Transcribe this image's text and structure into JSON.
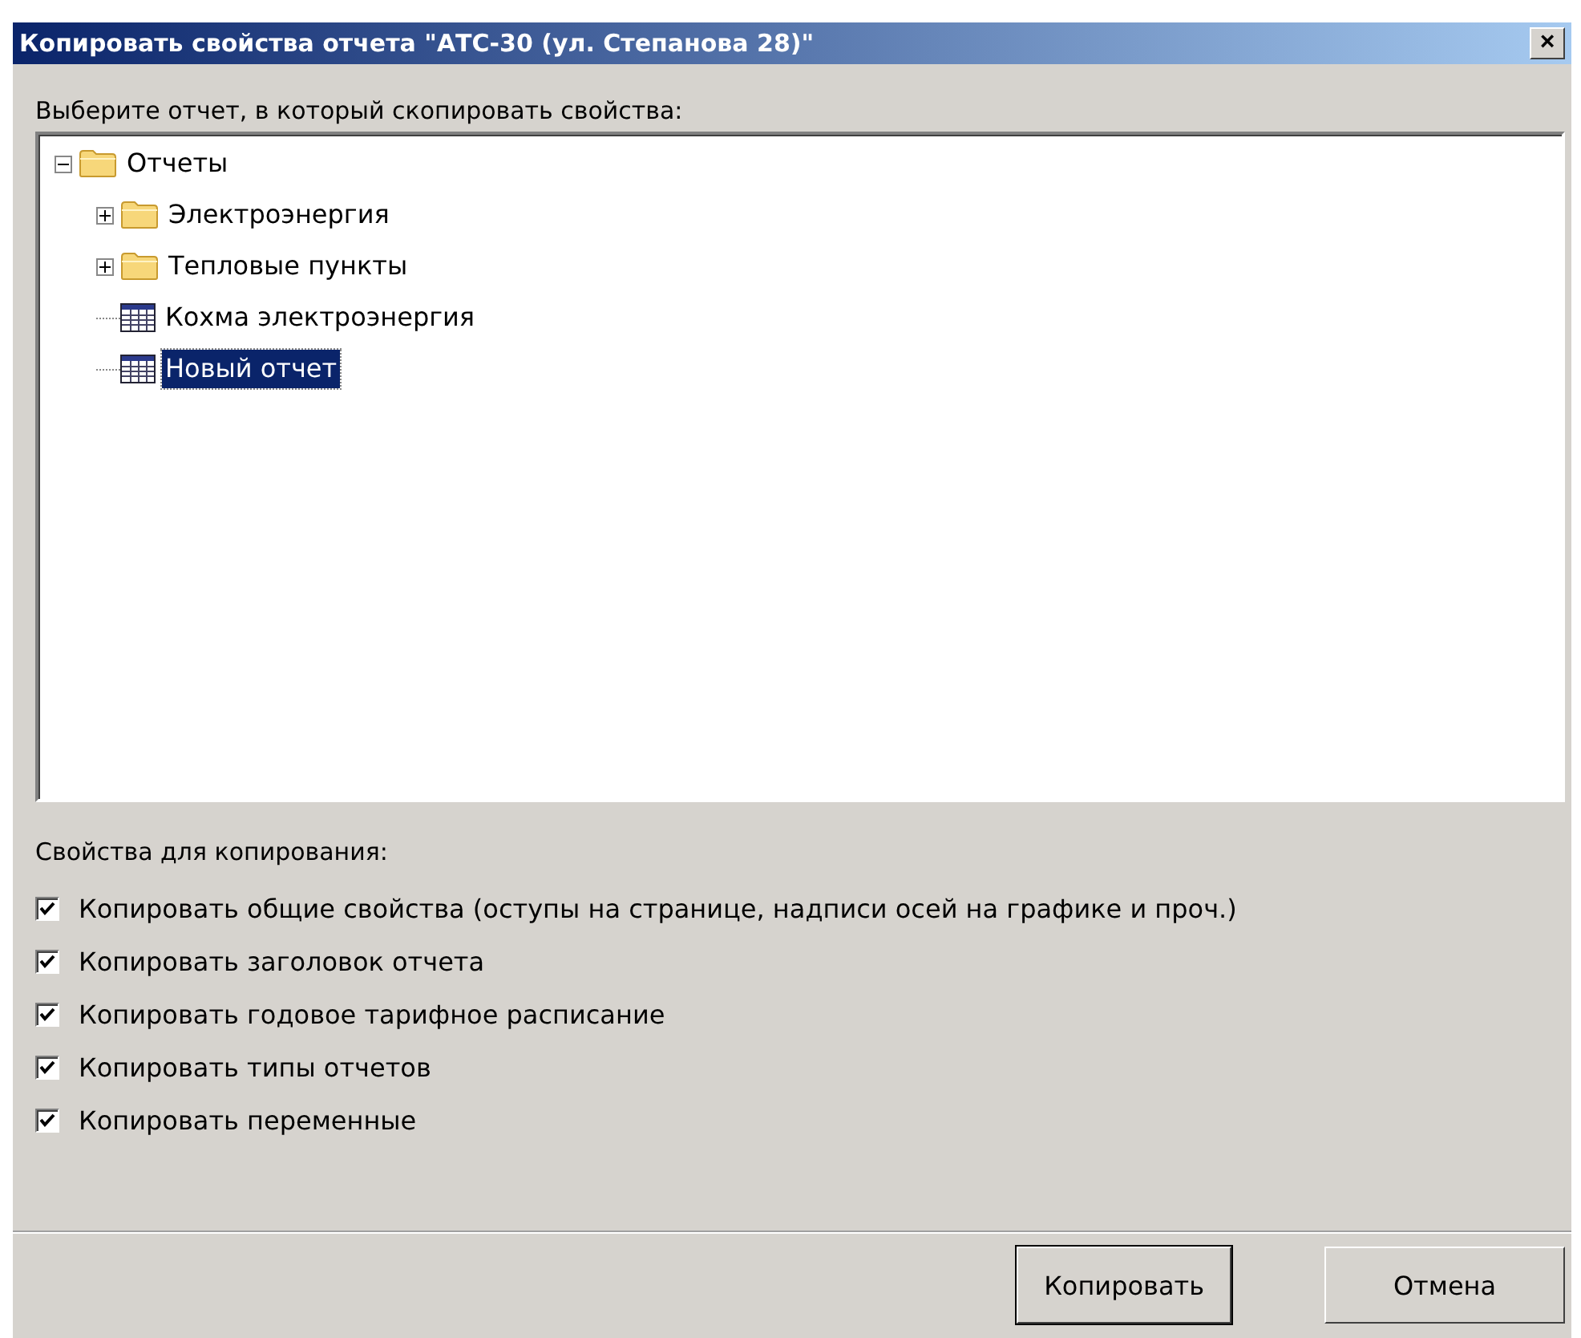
{
  "window": {
    "title": "Копировать свойства отчета \"АТС-30 (ул. Степанова 28)\"",
    "close": "×"
  },
  "tree_label": "Выберите отчет, в который скопировать свойства:",
  "tree": [
    {
      "label": "Отчеты",
      "kind": "folder",
      "expanded": true,
      "selected": false,
      "children": [
        {
          "label": "Электроэнергия",
          "kind": "folder",
          "expanded": false,
          "selected": false
        },
        {
          "label": "Тепловые пункты",
          "kind": "folder",
          "expanded": false,
          "selected": false
        },
        {
          "label": "Кохма электроэнергия",
          "kind": "report",
          "selected": false
        },
        {
          "label": "Новый отчет",
          "kind": "report",
          "selected": true
        }
      ]
    }
  ],
  "options_label": "Свойства для копирования:",
  "options": [
    {
      "label": "Копировать общие свойства (оступы на странице, надписи осей на графике и проч.)",
      "checked": true
    },
    {
      "label": "Копировать заголовок отчета",
      "checked": true
    },
    {
      "label": "Копировать годовое тарифное расписание",
      "checked": true
    },
    {
      "label": "Копировать типы отчетов",
      "checked": true
    },
    {
      "label": "Копировать переменные",
      "checked": true
    }
  ],
  "buttons": [
    {
      "label": "Копировать",
      "default": true
    },
    {
      "label": "Отмена",
      "default": false
    }
  ]
}
